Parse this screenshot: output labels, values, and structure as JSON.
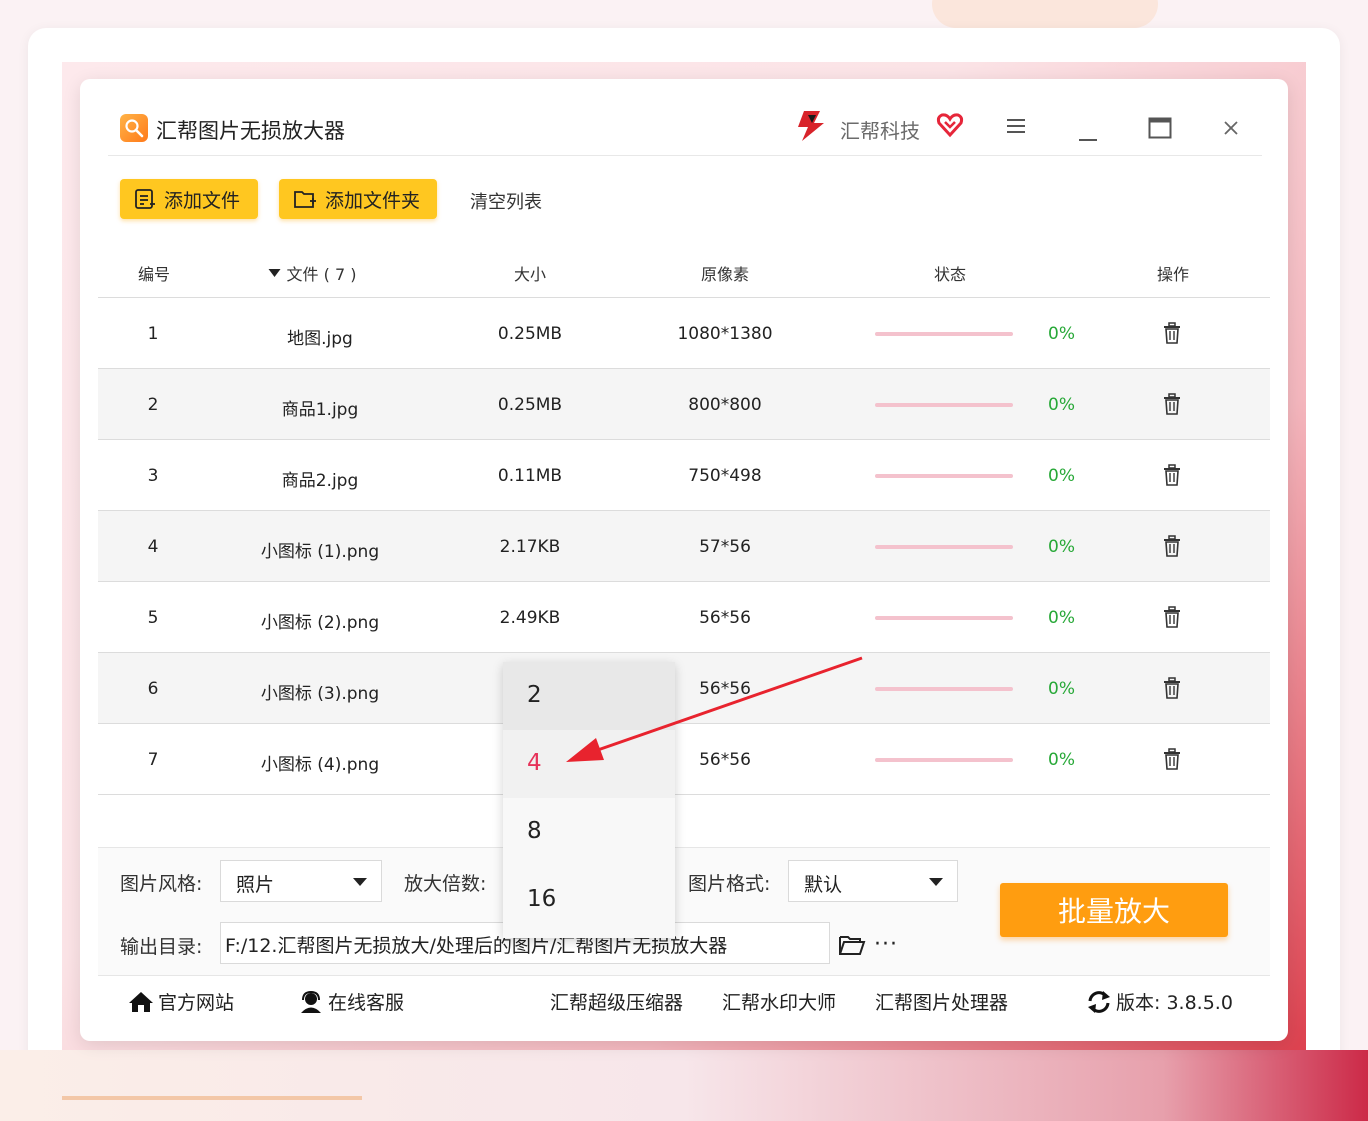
{
  "window": {
    "title": "汇帮图片无损放大器",
    "brand": "汇帮科技"
  },
  "toolbar": {
    "add_file": "添加文件",
    "add_folder": "添加文件夹",
    "clear_list": "清空列表"
  },
  "table": {
    "headers": {
      "id": "编号",
      "file": "文件 ( 7 )",
      "size": "大小",
      "pixels": "原像素",
      "status": "状态",
      "action": "操作"
    },
    "rows": [
      {
        "id": "1",
        "name": "地图.jpg",
        "size": "0.25MB",
        "pixels": "1080*1380",
        "progress": "0%"
      },
      {
        "id": "2",
        "name": "商品1.jpg",
        "size": "0.25MB",
        "pixels": "800*800",
        "progress": "0%"
      },
      {
        "id": "3",
        "name": "商品2.jpg",
        "size": "0.11MB",
        "pixels": "750*498",
        "progress": "0%"
      },
      {
        "id": "4",
        "name": "小图标 (1).png",
        "size": "2.17KB",
        "pixels": "57*56",
        "progress": "0%"
      },
      {
        "id": "5",
        "name": "小图标 (2).png",
        "size": "2.49KB",
        "pixels": "56*56",
        "progress": "0%"
      },
      {
        "id": "6",
        "name": "小图标 (3).png",
        "size": "",
        "pixels": "56*56",
        "progress": "0%"
      },
      {
        "id": "7",
        "name": "小图标 (4).png",
        "size": "",
        "pixels": "56*56",
        "progress": "0%"
      }
    ]
  },
  "settings": {
    "style_label": "图片风格:",
    "style_value": "照片",
    "scale_label": "放大倍数:",
    "format_label": "图片格式:",
    "format_value": "默认",
    "output_label": "输出目录:",
    "output_value": "F:/12.汇帮图片无损放大/处理后的图片/汇帮图片无损放大器",
    "more": "···",
    "batch_button": "批量放大"
  },
  "scale_dropdown": {
    "options": [
      "2",
      "4",
      "8",
      "16"
    ],
    "selected": "4",
    "hovered": "2"
  },
  "footer": {
    "website": "官方网站",
    "support": "在线客服",
    "compressor": "汇帮超级压缩器",
    "watermark": "汇帮水印大师",
    "processor": "汇帮图片处理器",
    "version": "版本:  3.8.5.0"
  },
  "colors": {
    "accent_yellow": "#ffc720",
    "batch_orange": "#ff9d10",
    "progress_pink": "#f4c2cd",
    "percent_green": "#27a837",
    "selected_red": "#e6335a",
    "arrow_red": "#e8232e"
  }
}
